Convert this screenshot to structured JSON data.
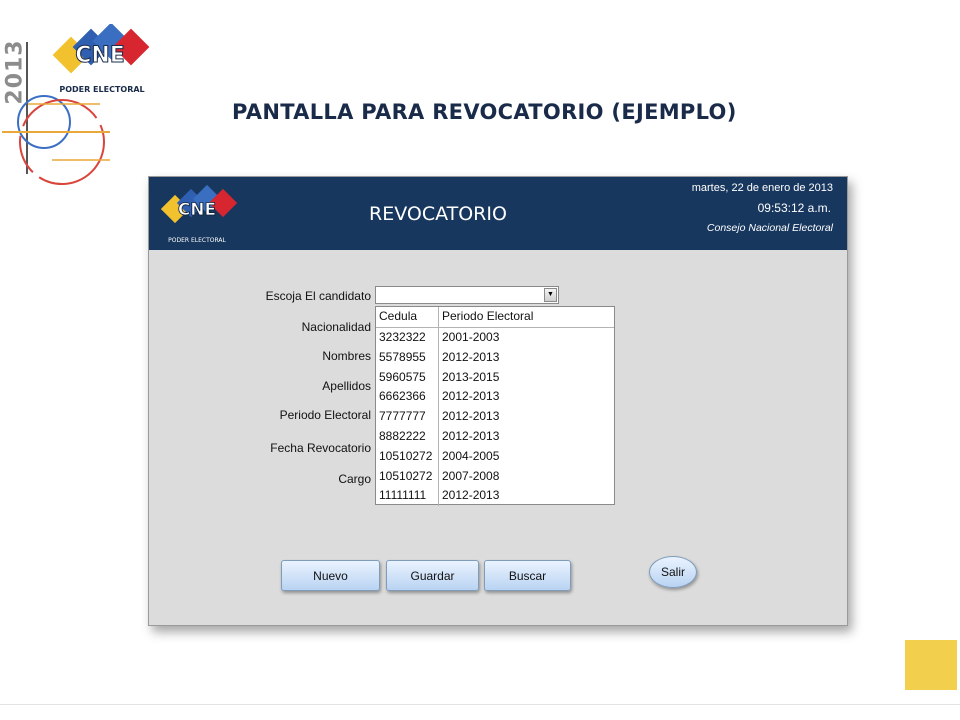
{
  "slide": {
    "year": "2013",
    "title": "PANTALLA PARA REVOCATORIO (EJEMPLO)",
    "logo_text": "CNE",
    "logo_subtext": "PODER ELECTORAL",
    "accent_color": "#f2d04e"
  },
  "app": {
    "title": "REVOCATORIO",
    "date": "martes, 22 de enero de 2013",
    "time": "09:53:12 a.m.",
    "org": "Consejo Nacional Electoral",
    "logo_text": "CNE",
    "logo_subtext": "PODER ELECTORAL",
    "header_color": "#17375e",
    "form": {
      "candidate_label": "Escoja El candidato",
      "candidate_value": "",
      "labels": {
        "nacionalidad": "Nacionalidad",
        "nombres": "Nombres",
        "apellidos": "Apellidos",
        "periodo": "Periodo Electoral",
        "fecha": "Fecha Revocatorio",
        "cargo": "Cargo"
      }
    },
    "dropdown": {
      "columns": [
        "Cedula",
        "Periodo Electoral"
      ],
      "rows": [
        [
          "3232322",
          "2001-2003"
        ],
        [
          "5578955",
          "2012-2013"
        ],
        [
          "5960575",
          "2013-2015"
        ],
        [
          "6662366",
          "2012-2013"
        ],
        [
          "7777777",
          "2012-2013"
        ],
        [
          "8882222",
          "2012-2013"
        ],
        [
          "10510272",
          "2004-2005"
        ],
        [
          "10510272",
          "2007-2008"
        ],
        [
          "11111111",
          "2012-2013"
        ]
      ]
    },
    "buttons": {
      "nuevo": "Nuevo",
      "guardar": "Guardar",
      "buscar": "Buscar",
      "salir": "Salir"
    }
  }
}
